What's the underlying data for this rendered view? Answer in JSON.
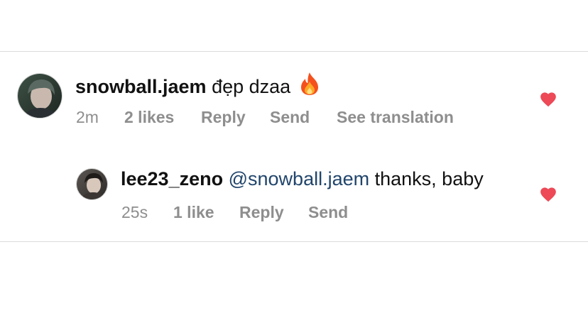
{
  "comment": {
    "username": "snowball.jaem",
    "text": "đẹp dzaa",
    "emoji_icon": "fire-emoji",
    "time": "2m",
    "likes": "2 likes",
    "reply": "Reply",
    "send": "Send",
    "translate": "See translation",
    "liked": true
  },
  "reply_comment": {
    "username": "lee23_zeno",
    "mention": "@snowball.jaem",
    "text": "thanks, baby",
    "time": "25s",
    "likes": "1 like",
    "reply": "Reply",
    "send": "Send",
    "liked": true
  },
  "colors": {
    "heart": "#ed4956",
    "mention": "#21456b",
    "meta": "#8e8e8e",
    "divider": "#dbdbdb"
  }
}
